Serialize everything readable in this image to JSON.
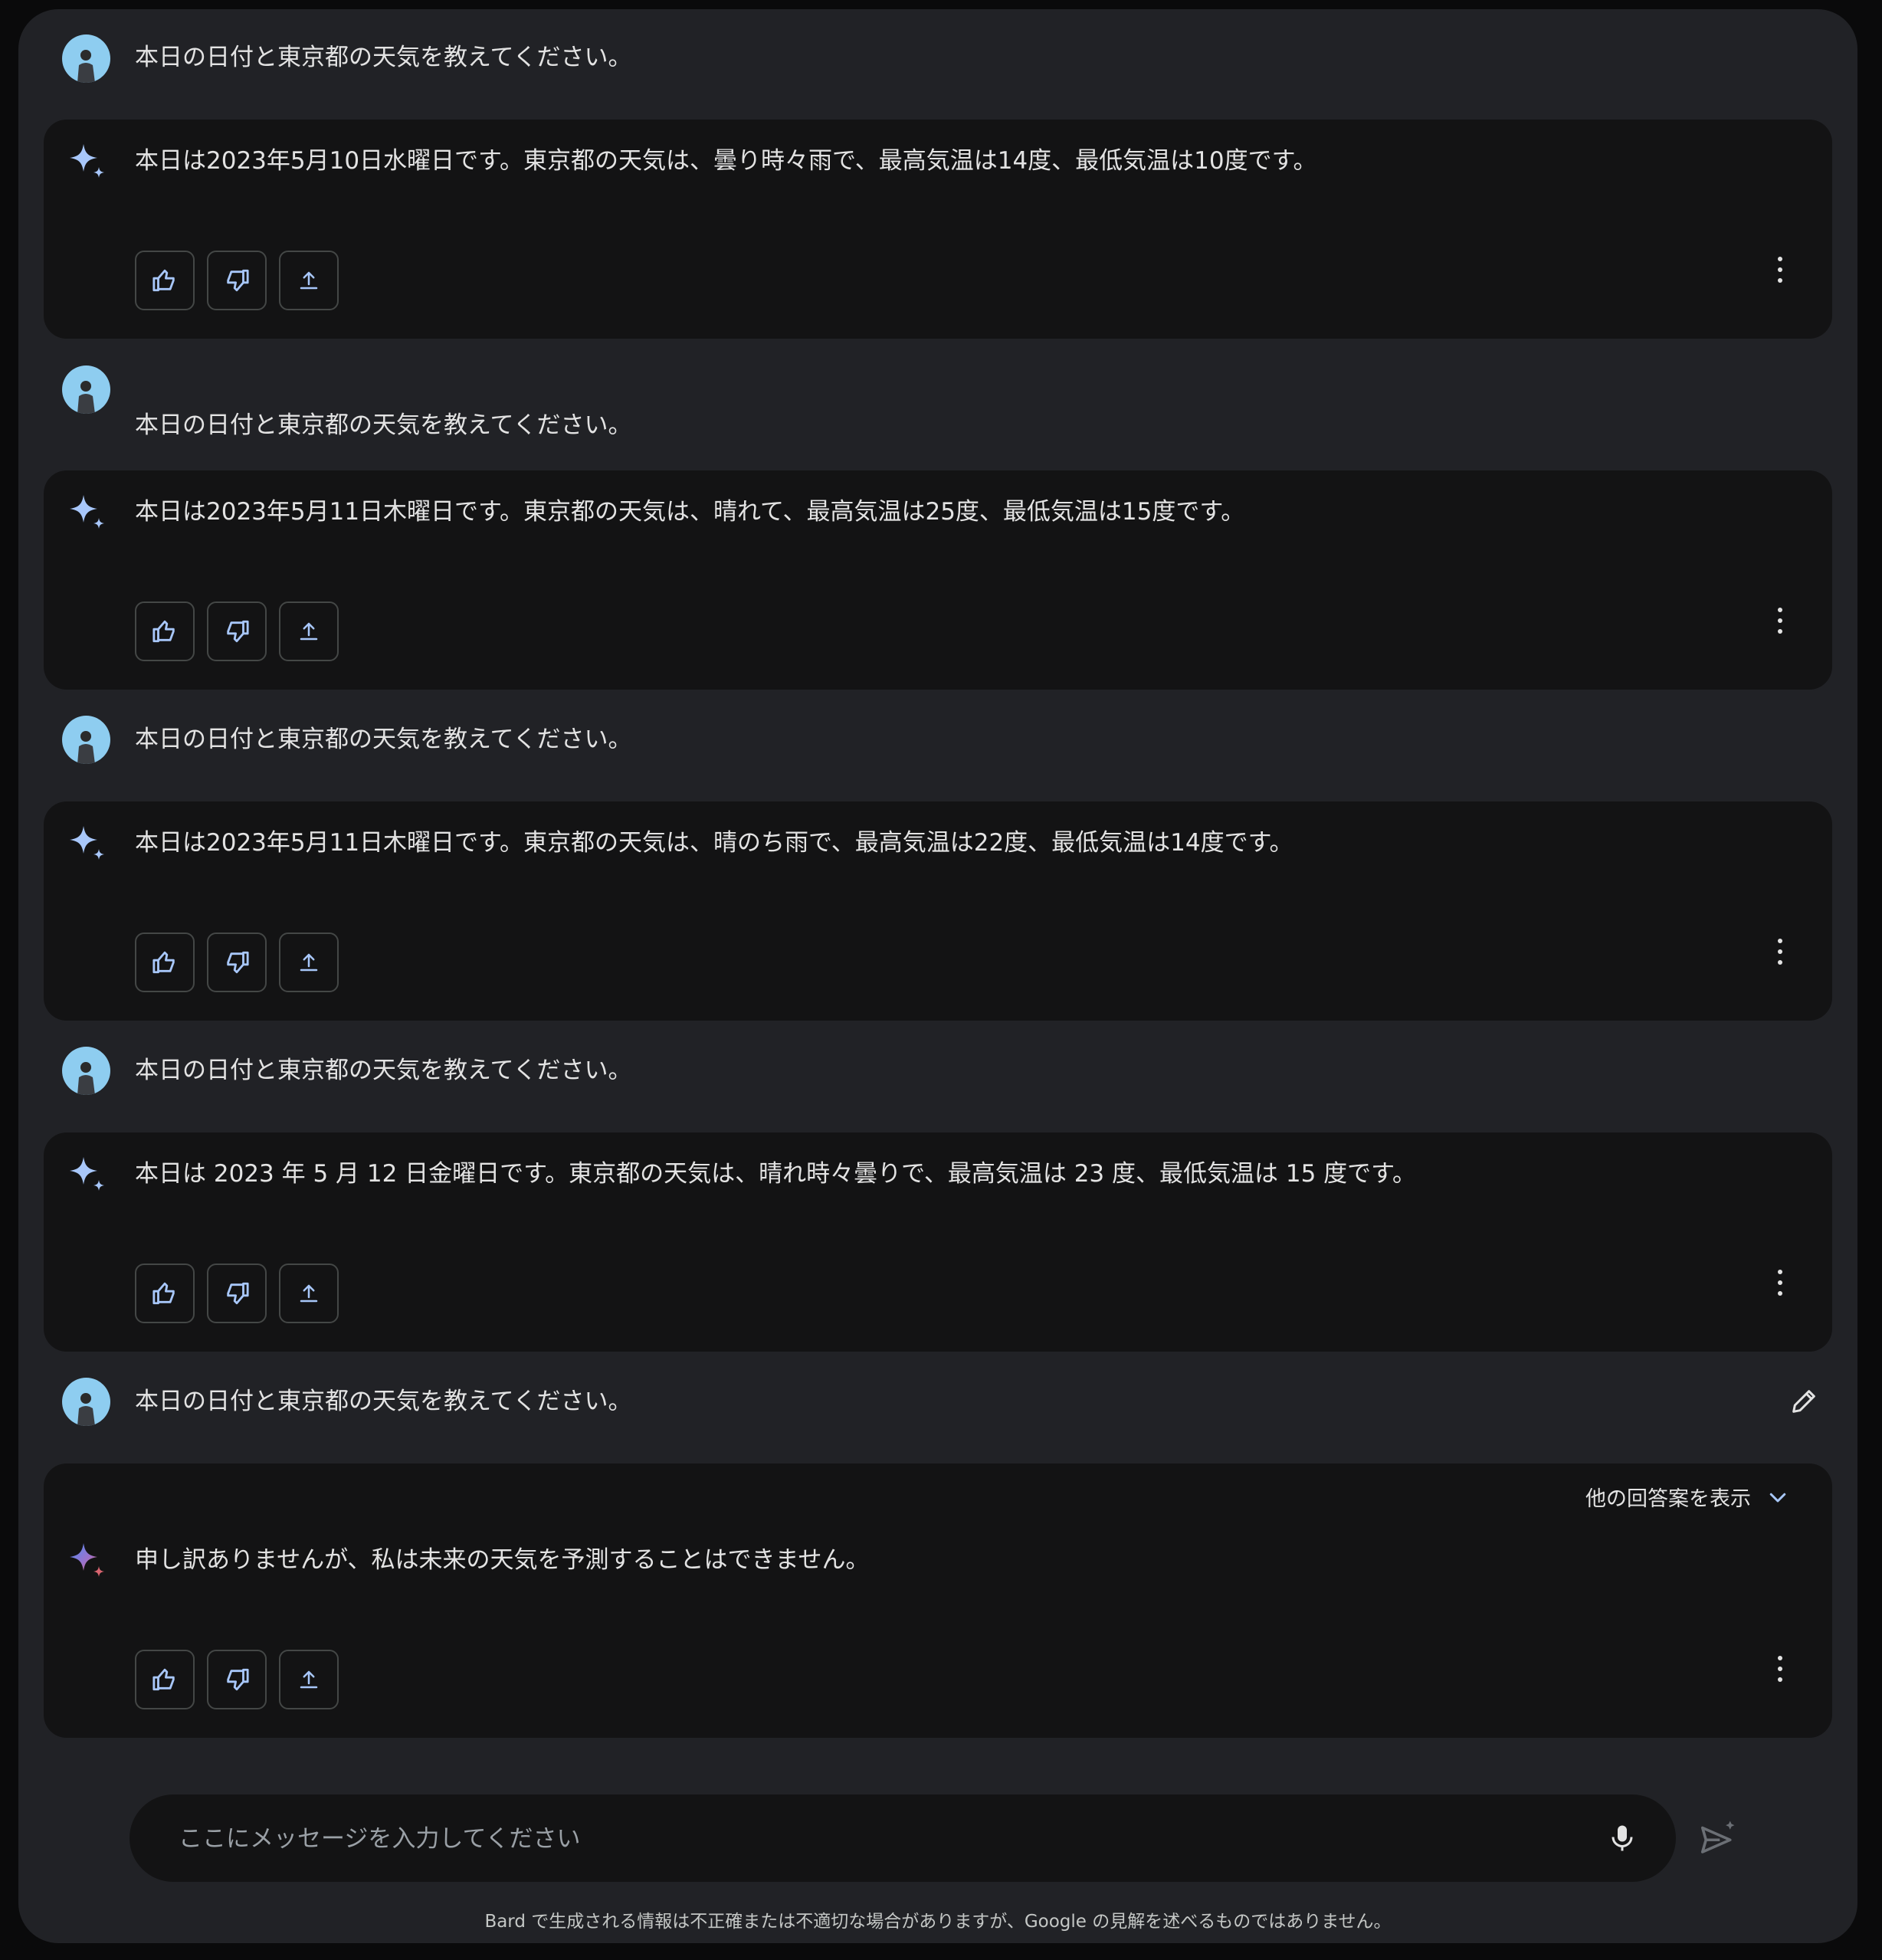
{
  "conversation": [
    {
      "user": "本日の日付と東京都の天気を教えてください。",
      "bot": "本日は2023年5月10日水曜日です。東京都の天気は、曇り時々雨で、最高気温は14度、最低気温は10度です。"
    },
    {
      "user": "本日の日付と東京都の天気を教えてください。",
      "bot": "本日は2023年5月11日木曜日です。東京都の天気は、晴れて、最高気温は25度、最低気温は15度です。"
    },
    {
      "user": "本日の日付と東京都の天気を教えてください。",
      "bot": "本日は2023年5月11日木曜日です。東京都の天気は、晴のち雨で、最高気温は22度、最低気温は14度です。"
    },
    {
      "user": "本日の日付と東京都の天気を教えてください。",
      "bot": "本日は 2023 年 5 月 12 日金曜日です。東京都の天気は、晴れ時々曇りで、最高気温は 23 度、最低気温は 15 度です。"
    },
    {
      "user": "本日の日付と東京都の天気を教えてください。",
      "bot": "申し訳ありませんが、私は未来の天気を予測することはできません。"
    }
  ],
  "drafts_label": "他の回答案を表示",
  "input": {
    "placeholder": "ここにメッセージを入力してください"
  },
  "disclaimer": "Bard で生成される情報は不正確または不適切な場合がありますが、Google の見解を述べるものではありません。",
  "icons": {
    "avatar": "user-avatar",
    "bard": "sparkle-icon",
    "like": "thumbs-up-icon",
    "dislike": "thumbs-down-icon",
    "share": "share-icon",
    "more": "more-vert-icon",
    "edit": "pencil-icon",
    "drafts": "chevron-down-icon",
    "mic": "mic-icon",
    "send": "send-icon"
  },
  "colors": {
    "background": "#212226",
    "card": "#131314",
    "accent": "#a8c7fa",
    "button_border": "#444746"
  }
}
